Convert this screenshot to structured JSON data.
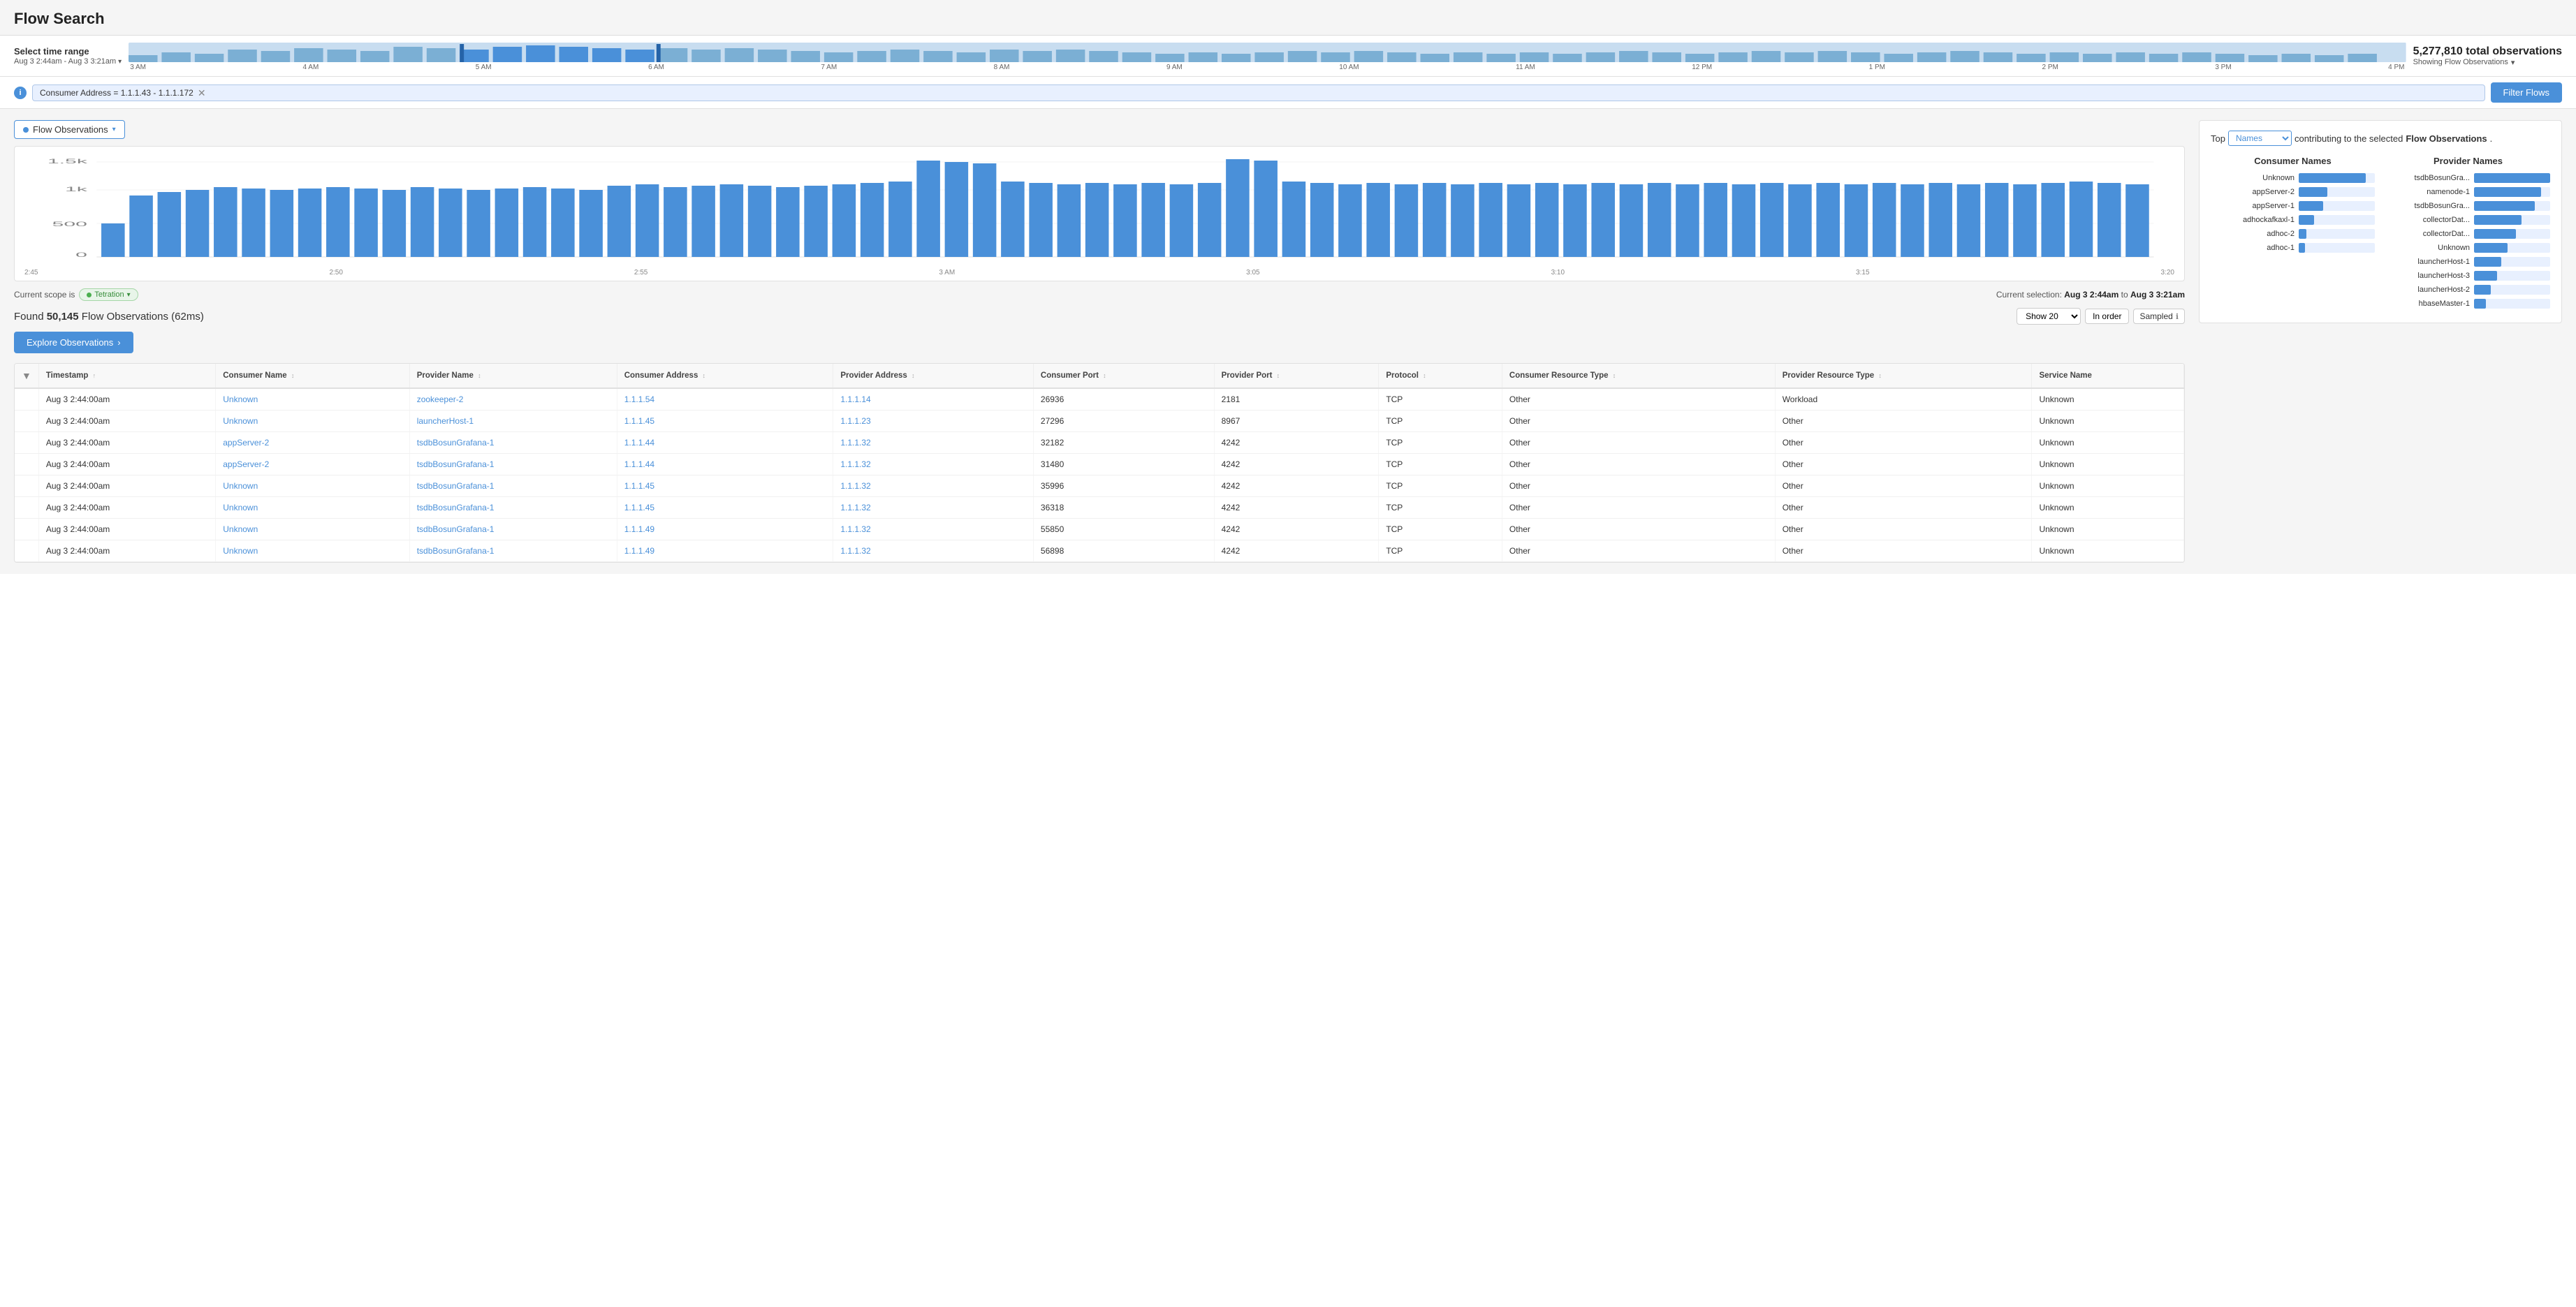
{
  "page": {
    "title": "Flow Search"
  },
  "timeRange": {
    "label": "Select time range",
    "sublabel": "Aug 3 2:44am - Aug 3 3:21am",
    "sublabel_arrow": "▾",
    "ticks": [
      "3 AM",
      "4 AM",
      "5 AM",
      "6 AM",
      "7 AM",
      "8 AM",
      "9 AM",
      "10 AM",
      "11 AM",
      "12 PM",
      "1 PM",
      "2 PM",
      "3 PM",
      "4 PM"
    ],
    "totalObs": "5,277,810 total observations",
    "showing": "Showing Flow Observations"
  },
  "filter": {
    "filterLabel": "Consumer Address = 1.1.1.43 - 1.1.1.172",
    "filterButtonLabel": "Filter Flows"
  },
  "flowObs": {
    "label": "Flow Observations",
    "dropdownArrow": "▾"
  },
  "histogram": {
    "yLabels": [
      "1.5k",
      "1k",
      "500",
      "0"
    ],
    "xLabels": [
      "2:45",
      "2:50",
      "2:55",
      "3 AM",
      "3:05",
      "3:10",
      "3:15",
      "3:20"
    ]
  },
  "scope": {
    "label": "Current scope is",
    "badge": "Tetration",
    "badgeArrow": "▾",
    "selectionLabel": "Current selection:",
    "selectionFrom": "Aug 3 2:44am",
    "selectionTo": "Aug 3 3:21am"
  },
  "found": {
    "text": "Found",
    "count": "50,145",
    "unit": "Flow Observations (62ms)",
    "showLabel": "Show 20",
    "showArrow": "▾",
    "inOrderLabel": "In order",
    "sampledLabel": "Sampled",
    "sampledInfoIcon": "ℹ"
  },
  "exploreBtn": {
    "label": "Explore Observations",
    "arrow": "›"
  },
  "table": {
    "columns": [
      {
        "id": "filter",
        "label": ""
      },
      {
        "id": "timestamp",
        "label": "Timestamp ↑"
      },
      {
        "id": "consumerName",
        "label": "Consumer Name ↕"
      },
      {
        "id": "providerName",
        "label": "Provider Name ↕"
      },
      {
        "id": "consumerAddress",
        "label": "Consumer Address ↕"
      },
      {
        "id": "providerAddress",
        "label": "Provider Address ↕"
      },
      {
        "id": "consumerPort",
        "label": "Consumer Port ↕"
      },
      {
        "id": "providerPort",
        "label": "Provider Port ↕"
      },
      {
        "id": "protocol",
        "label": "Protocol ↕"
      },
      {
        "id": "consumerResourceType",
        "label": "Consumer Resource Type ↕"
      },
      {
        "id": "providerResourceType",
        "label": "Provider Resource Type ↕"
      },
      {
        "id": "serviceName",
        "label": "Service Name"
      }
    ],
    "rows": [
      {
        "timestamp": "Aug 3 2:44:00am",
        "consumerName": "Unknown",
        "providerName": "zookeeper-2",
        "consumerAddress": "1.1.1.54",
        "providerAddress": "1.1.1.14",
        "consumerPort": "26936",
        "providerPort": "2181",
        "protocol": "TCP",
        "consumerResourceType": "Other",
        "providerResourceType": "Workload",
        "serviceName": "Unknown"
      },
      {
        "timestamp": "Aug 3 2:44:00am",
        "consumerName": "Unknown",
        "providerName": "launcherHost-1",
        "consumerAddress": "1.1.1.45",
        "providerAddress": "1.1.1.23",
        "consumerPort": "27296",
        "providerPort": "8967",
        "protocol": "TCP",
        "consumerResourceType": "Other",
        "providerResourceType": "Other",
        "serviceName": "Unknown"
      },
      {
        "timestamp": "Aug 3 2:44:00am",
        "consumerName": "appServer-2",
        "providerName": "tsdbBosunGrafana-1",
        "consumerAddress": "1.1.1.44",
        "providerAddress": "1.1.1.32",
        "consumerPort": "32182",
        "providerPort": "4242",
        "protocol": "TCP",
        "consumerResourceType": "Other",
        "providerResourceType": "Other",
        "serviceName": "Unknown"
      },
      {
        "timestamp": "Aug 3 2:44:00am",
        "consumerName": "appServer-2",
        "providerName": "tsdbBosunGrafana-1",
        "consumerAddress": "1.1.1.44",
        "providerAddress": "1.1.1.32",
        "consumerPort": "31480",
        "providerPort": "4242",
        "protocol": "TCP",
        "consumerResourceType": "Other",
        "providerResourceType": "Other",
        "serviceName": "Unknown"
      },
      {
        "timestamp": "Aug 3 2:44:00am",
        "consumerName": "Unknown",
        "providerName": "tsdbBosunGrafana-1",
        "consumerAddress": "1.1.1.45",
        "providerAddress": "1.1.1.32",
        "consumerPort": "35996",
        "providerPort": "4242",
        "protocol": "TCP",
        "consumerResourceType": "Other",
        "providerResourceType": "Other",
        "serviceName": "Unknown"
      },
      {
        "timestamp": "Aug 3 2:44:00am",
        "consumerName": "Unknown",
        "providerName": "tsdbBosunGrafana-1",
        "consumerAddress": "1.1.1.45",
        "providerAddress": "1.1.1.32",
        "consumerPort": "36318",
        "providerPort": "4242",
        "protocol": "TCP",
        "consumerResourceType": "Other",
        "providerResourceType": "Other",
        "serviceName": "Unknown"
      },
      {
        "timestamp": "Aug 3 2:44:00am",
        "consumerName": "Unknown",
        "providerName": "tsdbBosunGrafana-1",
        "consumerAddress": "1.1.1.49",
        "providerAddress": "1.1.1.32",
        "consumerPort": "55850",
        "providerPort": "4242",
        "protocol": "TCP",
        "consumerResourceType": "Other",
        "providerResourceType": "Other",
        "serviceName": "Unknown"
      },
      {
        "timestamp": "Aug 3 2:44:00am",
        "consumerName": "Unknown",
        "providerName": "tsdbBosunGrafana-1",
        "consumerAddress": "1.1.1.49",
        "providerAddress": "1.1.1.32",
        "consumerPort": "56898",
        "providerPort": "4242",
        "protocol": "TCP",
        "consumerResourceType": "Other",
        "providerResourceType": "Other",
        "serviceName": "Unknown"
      }
    ]
  },
  "topNames": {
    "prefix": "Top",
    "selectLabel": "Names",
    "suffix": "contributing to the selected",
    "bold": "Flow Observations",
    "consumer": {
      "title": "Consumer Names",
      "items": [
        {
          "label": "Unknown",
          "pct": 88
        },
        {
          "label": "appServer-2",
          "pct": 38
        },
        {
          "label": "appServer-1",
          "pct": 32
        },
        {
          "label": "adhockafkaxl-1",
          "pct": 20
        },
        {
          "label": "adhoc-2",
          "pct": 10
        },
        {
          "label": "adhoc-1",
          "pct": 8
        }
      ]
    },
    "provider": {
      "title": "Provider Names",
      "items": [
        {
          "label": "tsdbBosunGra...",
          "pct": 100
        },
        {
          "label": "namenode-1",
          "pct": 88
        },
        {
          "label": "tsdbBosunGra...",
          "pct": 80
        },
        {
          "label": "collectorDat...",
          "pct": 62
        },
        {
          "label": "collectorDat...",
          "pct": 55
        },
        {
          "label": "Unknown",
          "pct": 44
        },
        {
          "label": "launcherHost-1",
          "pct": 36
        },
        {
          "label": "launcherHost-3",
          "pct": 30
        },
        {
          "label": "launcherHost-2",
          "pct": 22
        },
        {
          "label": "hbaseMaster-1",
          "pct": 16
        }
      ]
    }
  }
}
